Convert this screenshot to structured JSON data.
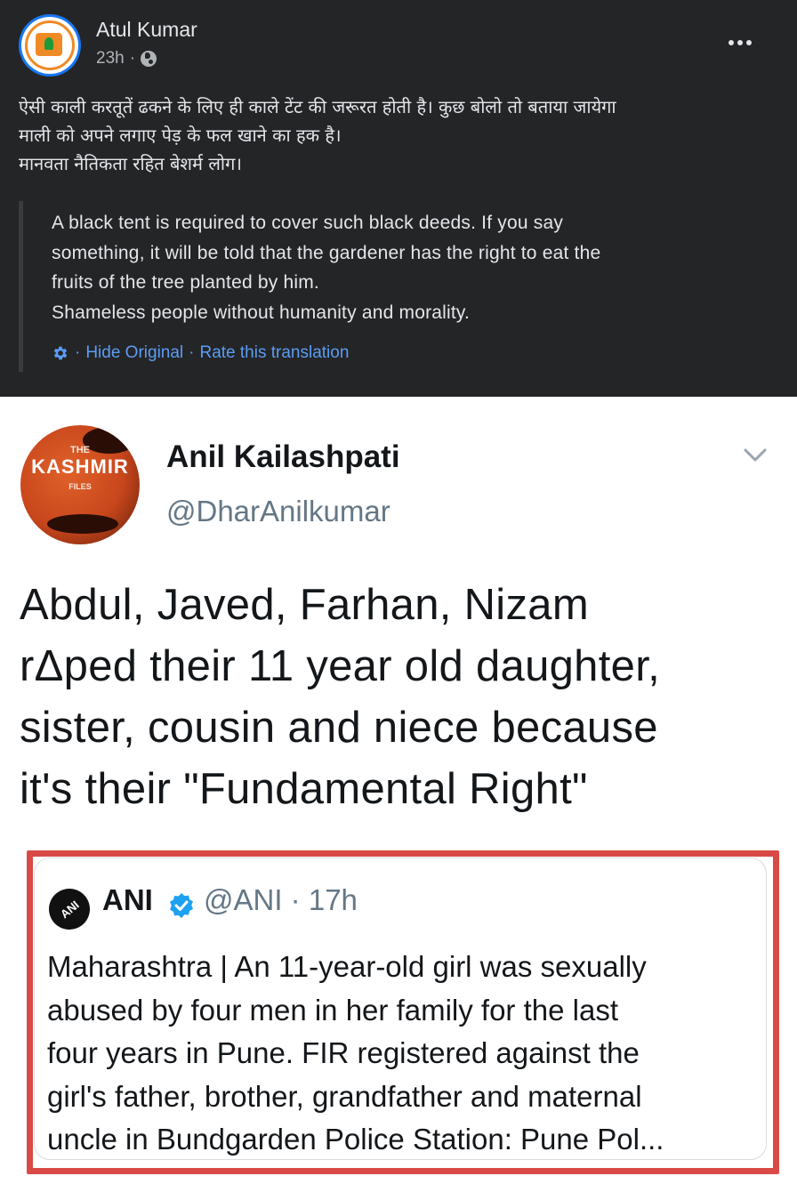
{
  "post": {
    "author": "Atul Kumar",
    "time": "23h",
    "separator": "·",
    "text_lines": [
      "ऐसी काली करतूतें ढकने के लिए ही काले टेंट की जरूरत होती है। कुछ बोलो तो बताया जायेगा",
      "माली को अपने लगाए पेड़ के फल खाने का हक है।",
      "मानवता नैतिकता रहित बेशर्म लोग।"
    ],
    "translation_lines": [
      "A black tent is required to cover such black deeds. If you say",
      "something, it will be told that the gardener has the right to eat the",
      "fruits of the tree planted by him.",
      "Shameless people without humanity and morality."
    ],
    "translation_links": {
      "dot": "·",
      "hide_original": "Hide Original",
      "rate": "Rate this translation"
    }
  },
  "tweet": {
    "name": "Anil Kailashpati",
    "handle": "@DharAnilkumar",
    "avatar_text": {
      "the": "THE",
      "title": "KASHMIR",
      "files": "FILES"
    },
    "body_lines": [
      "Abdul, Javed, Farhan, Nizam",
      "rΔped their 11 year old daughter,",
      "sister, cousin and niece because",
      "it's their \"Fundamental Right\""
    ],
    "quoted": {
      "logo_text": "ANI",
      "name": "ANI",
      "handle_time": "@ANI · 17h",
      "text_lines": [
        "Maharashtra | An 11-year-old girl was sexually",
        "abused by four men in her family for the last",
        "four years in Pune. FIR registered against the",
        "girl's father, brother, grandfather and maternal",
        "uncle in Bundgarden Police Station: Pune Pol..."
      ]
    }
  },
  "colors": {
    "background_dark": "#242526",
    "text_light": "#e4e6eb",
    "link_blue": "#5b9df5",
    "highlight_red": "#d94a47",
    "twitter_blue": "#1da1f2"
  }
}
